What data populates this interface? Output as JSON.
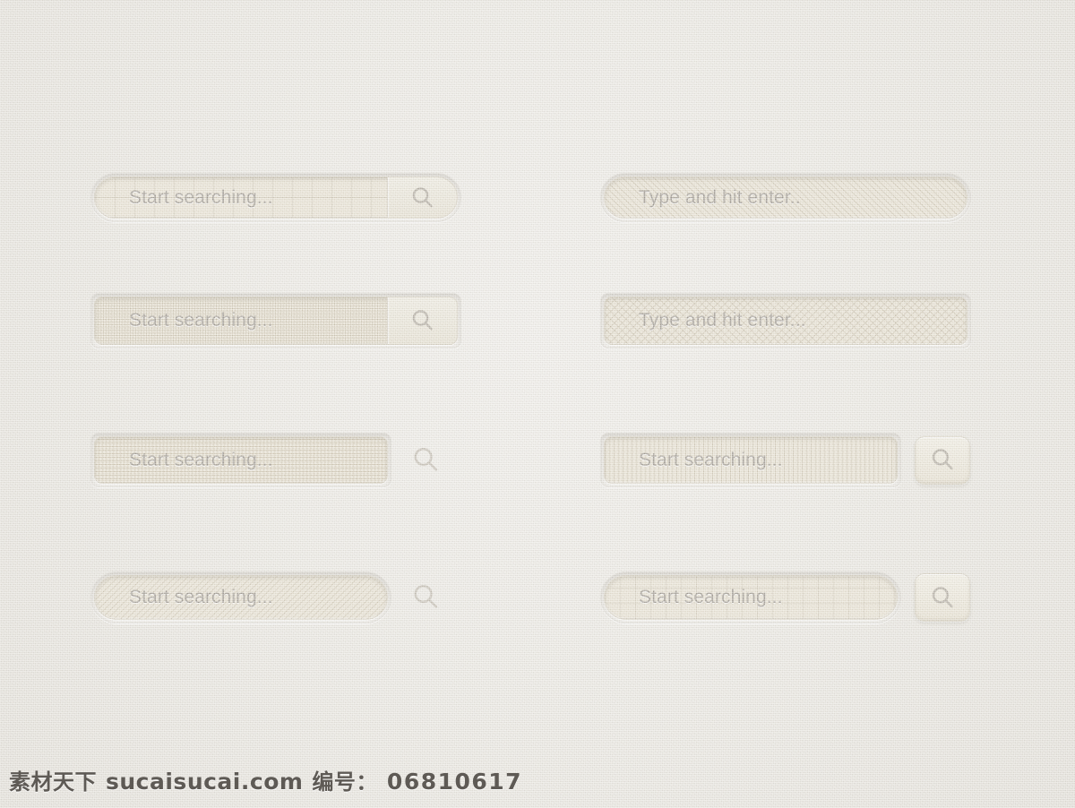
{
  "page": {
    "background_color": "#eceae5",
    "field_fill_color": "#e9e3d4",
    "placeholder_color": "#9d978e",
    "icon_color": "#b2aca1"
  },
  "search_bars": [
    {
      "id": "pill-grid-attached",
      "placeholder": "Start searching...",
      "shape": "pill",
      "texture": "grid",
      "button_style": "attached-segment",
      "icon": "search-icon"
    },
    {
      "id": "pill-diagonal-plain",
      "placeholder": "Type and hit enter..",
      "shape": "pill",
      "texture": "diagonal-stripes",
      "button_style": "none",
      "icon": ""
    },
    {
      "id": "rounded-dots-attached",
      "placeholder": "Start searching...",
      "shape": "rounded",
      "texture": "fine-dots",
      "button_style": "attached-segment",
      "icon": "search-icon"
    },
    {
      "id": "rounded-crosshatch-plain",
      "placeholder": "Type and hit enter...",
      "shape": "rounded",
      "texture": "crosshatch",
      "button_style": "none",
      "icon": ""
    },
    {
      "id": "rounded-dots-freeicon",
      "placeholder": "Start searching...",
      "shape": "rounded",
      "texture": "fine-dots",
      "button_style": "free-icon",
      "icon": "search-icon"
    },
    {
      "id": "rounded-vstripe-squarebtn",
      "placeholder": "Start searching...",
      "shape": "rounded",
      "texture": "vertical-stripes",
      "button_style": "square-button",
      "icon": "search-icon"
    },
    {
      "id": "pill-diagonal-freeicon",
      "placeholder": "Start searching...",
      "shape": "pill",
      "texture": "diagonal-stripes",
      "button_style": "free-icon",
      "icon": "search-icon"
    },
    {
      "id": "pill-grid-squarebtn",
      "placeholder": "Start searching...",
      "shape": "pill",
      "texture": "grid",
      "button_style": "square-button",
      "icon": "search-icon"
    }
  ],
  "watermark": {
    "site_cn": "素材天下",
    "site_url": "sucaisucai.com",
    "label_cn": "编号：",
    "number": "06810617"
  }
}
